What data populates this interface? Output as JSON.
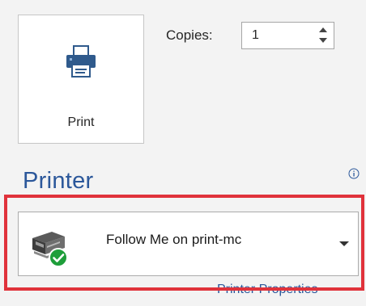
{
  "print_button": {
    "label": "Print",
    "icon": "printer-icon"
  },
  "copies": {
    "label": "Copies:",
    "value": "1"
  },
  "printer": {
    "heading": "Printer",
    "info_icon": "info-icon",
    "selected_printer": "Follow Me on print-mc",
    "status_icon": "ready-checkmark-icon",
    "properties_link": "Printer Properties"
  },
  "colors": {
    "accent": "#2b579a",
    "highlight_border": "#e0323b",
    "status_ok": "#1e9e3a",
    "background": "#f3f3f3"
  }
}
